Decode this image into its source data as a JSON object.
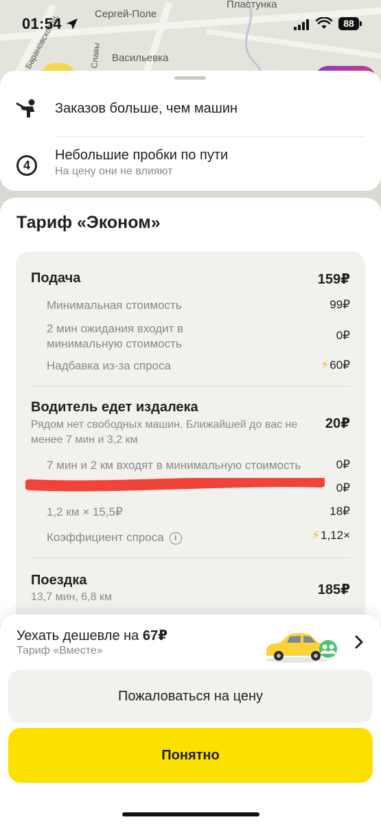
{
  "status_bar": {
    "time": "01:54",
    "battery": "88"
  },
  "map": {
    "labels": [
      "Сергей-Поле",
      "Пластунка",
      "Васильевка",
      "ул. Славы",
      "Барановское ш."
    ]
  },
  "top_card": {
    "demand_text": "Заказов больше, чем машин",
    "traffic_level": "4",
    "traffic_title": "Небольшие пробки по пути",
    "traffic_sub": "На цену они не влияют"
  },
  "tariff": {
    "title": "Тариф «Эконом»",
    "pickup": {
      "title": "Подача",
      "price": "159₽",
      "items": [
        {
          "label": "Минимальная стоимость",
          "value": "99₽"
        },
        {
          "label": "2 мин ожидания входит в минимальную стоимость",
          "value": "0₽"
        },
        {
          "label": "Надбавка из-за спроса",
          "value": "60₽"
        }
      ]
    },
    "far": {
      "title": "Водитель едет издалека",
      "desc": "Рядом нет свободных машин. Ближайшей до вас не менее 7 мин и 3,2 км",
      "price": "20₽",
      "items": [
        {
          "label": "7 мин и 2 км входят в минимальную стоимость",
          "value": "0₽"
        },
        {
          "label": "",
          "value": "0₽"
        },
        {
          "label": "1,2 км × 15,5₽",
          "value": "18₽"
        },
        {
          "label": "Коэффициент спроса",
          "value": "1,12×"
        }
      ]
    },
    "ride": {
      "title": "Поездка",
      "desc": "13,7 мин, 6,8 км",
      "price": "185₽"
    }
  },
  "bottom": {
    "cheaper_prefix": "Уехать дешевле на ",
    "cheaper_amount": "67₽",
    "cheaper_sub": "Тариф «Вместе»",
    "complain_label": "Пожаловаться на цену",
    "ok_label": "Понятно"
  },
  "colors": {
    "accent_yellow": "#fce000",
    "bolt": "#f6b90e",
    "redaction": "#f0433a"
  }
}
